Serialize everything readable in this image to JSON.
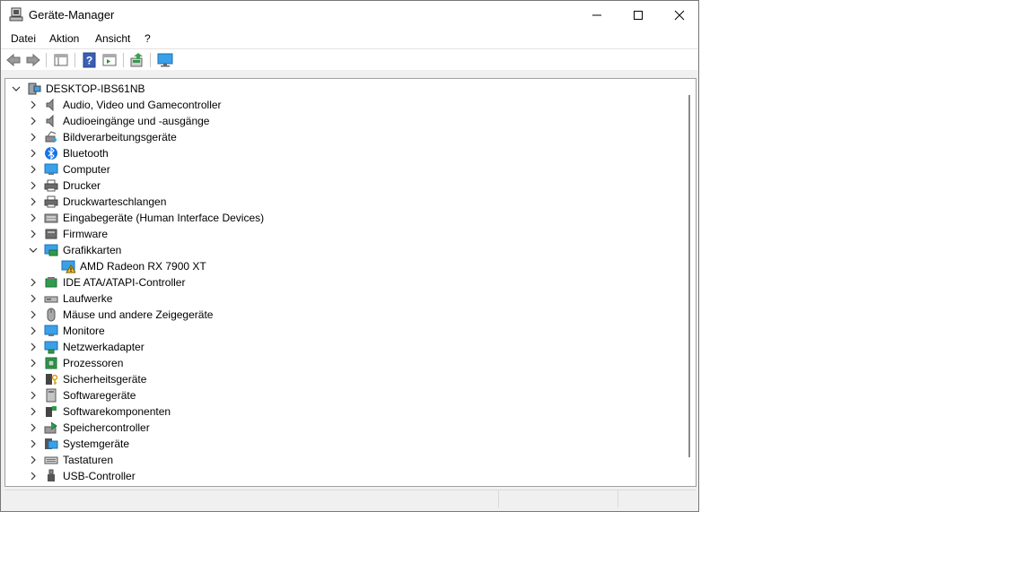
{
  "window": {
    "title": "Geräte-Manager"
  },
  "menu": [
    "Datei",
    "Aktion",
    "Ansicht",
    "?"
  ],
  "toolbar": [
    {
      "name": "back-button",
      "icon": "arrow-left-icon"
    },
    {
      "name": "forward-button",
      "icon": "arrow-right-icon"
    },
    {
      "name": "show-hide-console-tree-button",
      "icon": "console-tree-icon"
    },
    {
      "name": "help-button",
      "icon": "help-icon"
    },
    {
      "name": "action-pane-button",
      "icon": "action-pane-icon"
    },
    {
      "name": "update-driver-button",
      "icon": "update-driver-icon"
    },
    {
      "name": "scan-hardware-button",
      "icon": "monitor-scan-icon"
    }
  ],
  "tree": {
    "root": {
      "label": "DESKTOP-IBS61NB",
      "icon": "computer-tower-icon",
      "expanded": true
    },
    "items": [
      {
        "label": "Audio, Video und Gamecontroller",
        "icon": "speaker-icon"
      },
      {
        "label": "Audioeingänge und -ausgänge",
        "icon": "speaker-icon"
      },
      {
        "label": "Bildverarbeitungsgeräte",
        "icon": "camera-icon"
      },
      {
        "label": "Bluetooth",
        "icon": "bluetooth-icon"
      },
      {
        "label": "Computer",
        "icon": "monitor-icon"
      },
      {
        "label": "Drucker",
        "icon": "printer-icon"
      },
      {
        "label": "Druckwarteschlangen",
        "icon": "printer-icon"
      },
      {
        "label": "Eingabegeräte (Human Interface Devices)",
        "icon": "hid-icon"
      },
      {
        "label": "Firmware",
        "icon": "firmware-icon"
      },
      {
        "label": "Grafikkarten",
        "icon": "display-adapter-icon",
        "expanded": true,
        "children": [
          {
            "label": "AMD Radeon RX 7900 XT",
            "icon": "display-adapter-warning-icon"
          }
        ]
      },
      {
        "label": "IDE ATA/ATAPI-Controller",
        "icon": "ide-controller-icon"
      },
      {
        "label": "Laufwerke",
        "icon": "drive-icon"
      },
      {
        "label": "Mäuse und andere Zeigegeräte",
        "icon": "mouse-icon"
      },
      {
        "label": "Monitore",
        "icon": "monitor-icon"
      },
      {
        "label": "Netzwerkadapter",
        "icon": "network-adapter-icon"
      },
      {
        "label": "Prozessoren",
        "icon": "processor-icon"
      },
      {
        "label": "Sicherheitsgeräte",
        "icon": "security-device-icon"
      },
      {
        "label": "Softwaregeräte",
        "icon": "software-device-icon"
      },
      {
        "label": "Softwarekomponenten",
        "icon": "software-component-icon"
      },
      {
        "label": "Speichercontroller",
        "icon": "storage-controller-icon"
      },
      {
        "label": "Systemgeräte",
        "icon": "system-devices-icon"
      },
      {
        "label": "Tastaturen",
        "icon": "keyboard-icon"
      },
      {
        "label": "USB-Controller",
        "icon": "usb-icon"
      }
    ]
  },
  "colors": {
    "warning": "#f2c12e",
    "bluetooth": "#1a73e8",
    "monitor": "#3aa0e8"
  }
}
